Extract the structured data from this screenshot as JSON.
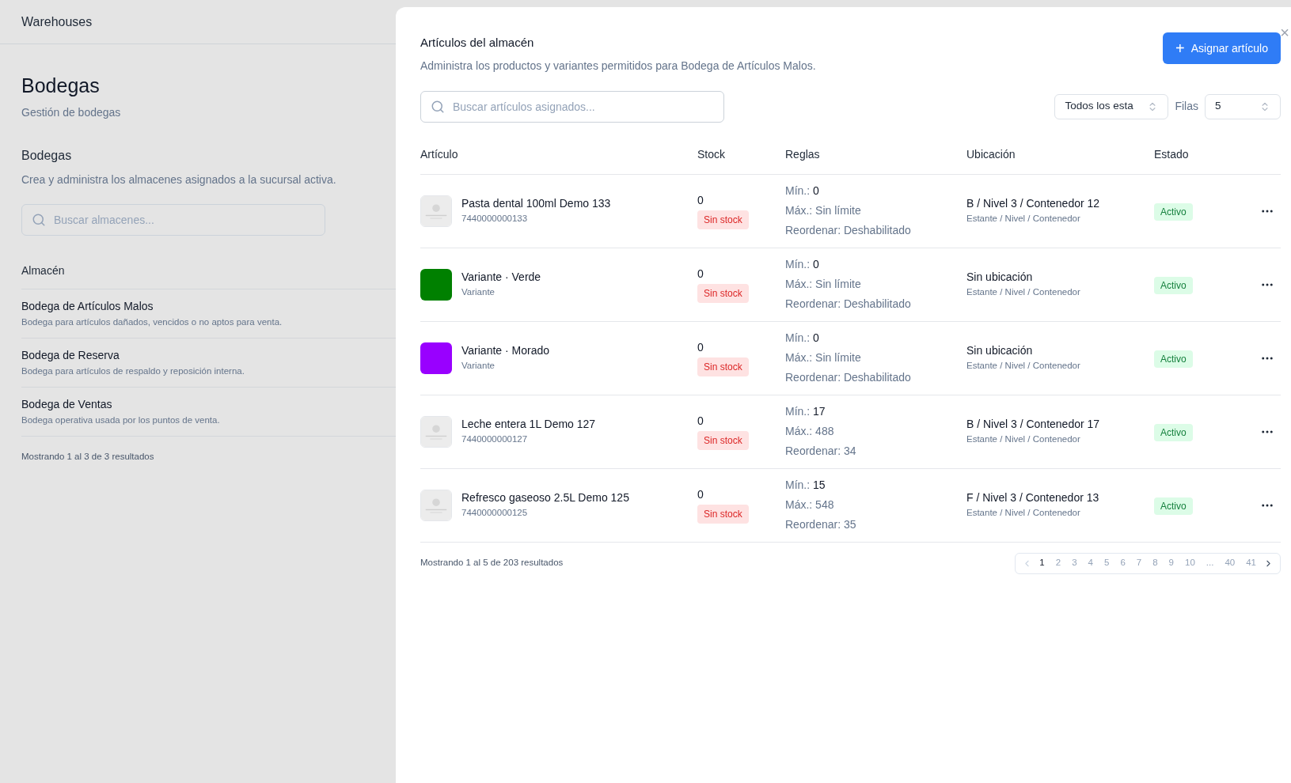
{
  "sidebar": {
    "title": "Warehouses"
  },
  "page": {
    "title": "Bodegas",
    "subtitle": "Gestión de bodegas",
    "section_title": "Bodegas",
    "section_description": "Crea y administra los almacenes asignados a la sucursal activa.",
    "search": {
      "placeholder": "Buscar almacenes..."
    },
    "column": "Almacén",
    "warehouses": [
      {
        "name": "Bodega de Artículos Malos",
        "description": "Bodega para artículos dañados, vencidos o no aptos para venta."
      },
      {
        "name": "Bodega de Reserva",
        "description": "Bodega para artículos de respaldo y reposición interna."
      },
      {
        "name": "Bodega de Ventas",
        "description": "Bodega operativa usada por los puntos de venta."
      }
    ],
    "footer": "Mostrando 1 al 3 de 3 resultados"
  },
  "panel": {
    "title": "Artículos del almacén",
    "description": "Administra los productos y variantes permitidos para Bodega de Artículos Malos.",
    "close": "×",
    "assign_button": {
      "icon": "+",
      "label": "Asignar artículo"
    },
    "search": {
      "placeholder": "Buscar artículos asignados..."
    },
    "status_filter": "Todos los esta",
    "rows_label": "Filas",
    "rows_value": "5",
    "columns": [
      "Artículo",
      "Stock",
      "Reglas",
      "Ubicación",
      "Estado"
    ],
    "rows": [
      {
        "name": "Pasta dental 100ml Demo 133",
        "sub": "7440000000133",
        "stock": "0",
        "stock_badge": "Sin stock",
        "min": "Mín.: **0**",
        "max": "Máx.: Sin límite",
        "reorder": "Reordenar: Deshabilitado",
        "location": "B / Nivel 3 / Contenedor 12",
        "location_hint": "Estante / Nivel / Contenedor",
        "status": "Activo"
      },
      {
        "thumb": {
          "kind": "swatch",
          "color": "#008000"
        },
        "name": "Variante · Verde",
        "sub": "Variante",
        "stock": "0",
        "stock_badge": "Sin stock",
        "min": "Mín.: **0**",
        "max": "Máx.: Sin límite",
        "reorder": "Reordenar: Deshabilitado",
        "location": "Sin ubicación",
        "location_hint": "Estante / Nivel / Contenedor",
        "status": "Activo"
      },
      {
        "thumb": {
          "kind": "swatch",
          "color": "#9900ff"
        },
        "name": "Variante · Morado",
        "sub": "Variante",
        "stock": "0",
        "stock_badge": "Sin stock",
        "min": "Mín.: **0**",
        "max": "Máx.: Sin límite",
        "reorder": "Reordenar: Deshabilitado",
        "location": "Sin ubicación",
        "location_hint": "Estante / Nivel / Contenedor",
        "status": "Activo"
      },
      {
        "name": "Leche entera 1L Demo 127",
        "sub": "7440000000127",
        "stock": "0",
        "stock_badge": "Sin stock",
        "min": "Mín.: **17**",
        "max": "Máx.: 488",
        "reorder": "Reordenar: 34",
        "location": "B / Nivel 3 / Contenedor 17",
        "location_hint": "Estante / Nivel / Contenedor",
        "status": "Activo"
      },
      {
        "name": "Refresco gaseoso 2.5L Demo 125",
        "sub": "7440000000125",
        "stock": "0",
        "stock_badge": "Sin stock",
        "min": "Mín.: **15**",
        "max": "Máx.: 548",
        "reorder": "Reordenar: 35",
        "location": "F / Nivel 3 / Contenedor 13",
        "location_hint": "Estante / Nivel / Contenedor",
        "status": "Activo"
      }
    ],
    "footer": "Mostrando 1 al 5 de 203 resultados",
    "pagination": {
      "prev_disabled": true,
      "pages": [
        {
          "label": "1",
          "selected": true
        },
        {
          "label": "2",
          "selected": false
        },
        {
          "label": "3",
          "selected": false
        },
        {
          "label": "4",
          "selected": false
        },
        {
          "label": "5",
          "selected": false
        },
        {
          "label": "6",
          "selected": false
        },
        {
          "label": "7",
          "selected": false
        },
        {
          "label": "8",
          "selected": false
        },
        {
          "label": "9",
          "selected": false
        },
        {
          "label": "10",
          "selected": false
        },
        {
          "label": "...",
          "selected": false
        },
        {
          "label": "40",
          "selected": false
        },
        {
          "label": "41",
          "selected": false
        }
      ]
    }
  }
}
